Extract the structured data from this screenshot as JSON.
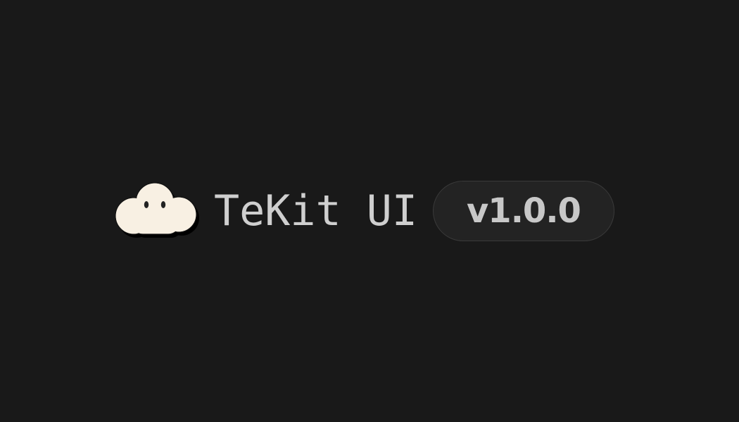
{
  "brand": {
    "name": "TeKit UI",
    "version": "v1.0.0",
    "logo_icon": "cloud-mascot-icon"
  },
  "colors": {
    "background": "#191919",
    "title_text": "#cfcfcf",
    "badge_background": "#232323",
    "badge_border": "#3a3a3a",
    "badge_text": "#c8c8c8",
    "logo_fill": "#f8f0e3"
  }
}
